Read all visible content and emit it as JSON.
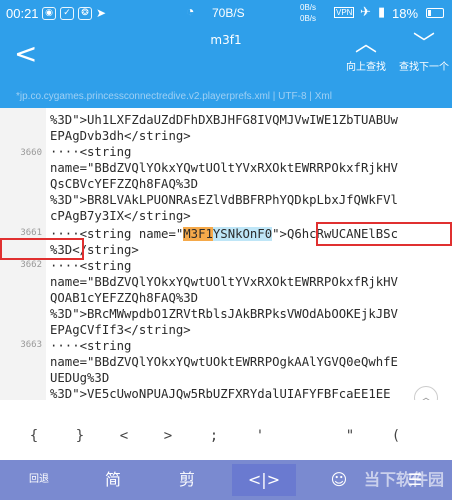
{
  "status_bar": {
    "time": "00:21",
    "speed": "70B/S",
    "net_speed_top": "0B/s",
    "net_speed_bottom": "0B/s",
    "vpn": "VPN",
    "battery": "18%"
  },
  "app_bar": {
    "title": "m3f1",
    "find_prev_label": "向上查找",
    "find_next_label": "查找下一个"
  },
  "path_bar": {
    "path": "*jp.co.cygames.princessconnectredive.v2.playerprefs.xml",
    "encoding": "UTF-8",
    "syntax": "Xml"
  },
  "editor": {
    "line_numbers": [
      "3660",
      "3661",
      "3662",
      "3663"
    ],
    "lines": [
      "%3D\">Uh1LXFZdaUZdDFhDXBJHFG8IVQMJVwIWE1ZbTUABUw",
      "EPAgDvb3dh</string>",
      "····<string",
      "name=\"BBdZVQlYOkxYQwtUOltYVxRXOktEWRRPOkxfRjkHV",
      "QsCBVcYEFZZQh8FAQ%3D",
      "%3D\">BR8LVAkLPUONRAsEZlVdBBFRPhYQDkpLbxJfQWkFVl",
      "cPAgB7y3IX</string>",
      "",
      "%3D</string>",
      "name=\"BBdZVQlYOkxYQwtUOltYVxRXOktEWRRPOkxfRjkHV",
      "QOAB1cYEFZZQh8FAQ%3D",
      "%3D\">BRcMWwpdbO1ZRVtRblsJAkBRPksVWOdAbOOKEjkJBV",
      "EPAgCVfIf3</string>",
      "····<string",
      "name=\"BBdZVQlYOkxYQwtUOktEWRRPOgkAAlYGVQ0eQwhfE",
      "UEDUg%3D",
      "%3D\">VE5cUwoNPUAJQw5RbUZFXRYdalUIAFYFBFcaEE1EE"
    ],
    "highlight_line": {
      "prefix": "····<string name=\"",
      "key_part1": "M3F1",
      "key_part2": "YSNkOnF0",
      "mid": "\">",
      "value": "Q6hcRwUCANElBSc"
    }
  },
  "symbols": [
    "{",
    "}",
    "<",
    ">",
    ";",
    "'",
    "\"",
    "("
  ],
  "bottom_toolbar": {
    "items": [
      "回退",
      "简",
      "剪",
      "<|>",
      "☺",
      "☰"
    ],
    "watermark": "当下软件园"
  }
}
